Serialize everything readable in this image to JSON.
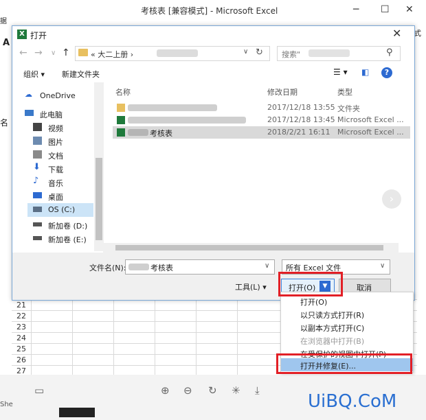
{
  "excel": {
    "title": "考核表 [兼容模式] - Microsoft Excel",
    "rows": [
      "21",
      "22",
      "23",
      "24",
      "25",
      "26",
      "27"
    ],
    "left_fragments": [
      "A",
      "名",
      "She"
    ],
    "right_fragment": "式"
  },
  "dialog": {
    "title": "打开",
    "close_glyph": "✕",
    "nav": {
      "back": "←",
      "forward": "→",
      "down": "∨",
      "up": "↑"
    },
    "address": {
      "prefix": "«",
      "crumb": "大二上册",
      "sep": "›"
    },
    "search_placeholder": "搜索\"",
    "toolbar": {
      "organize": "组织 ▾",
      "new_folder": "新建文件夹"
    },
    "nav_pane": [
      {
        "label": "OneDrive",
        "icon": "cloud-icon"
      },
      {
        "label": "此电脑",
        "icon": "computer-icon"
      },
      {
        "label": "视频",
        "icon": "video-icon"
      },
      {
        "label": "图片",
        "icon": "picture-icon"
      },
      {
        "label": "文档",
        "icon": "document-icon"
      },
      {
        "label": "下载",
        "icon": "download-icon"
      },
      {
        "label": "音乐",
        "icon": "music-icon"
      },
      {
        "label": "桌面",
        "icon": "desktop-icon"
      },
      {
        "label": "OS (C:)",
        "icon": "drive-icon"
      },
      {
        "label": "新加卷 (D:)",
        "icon": "drive-icon"
      },
      {
        "label": "新加卷 (E:)",
        "icon": "drive-icon"
      }
    ],
    "columns": {
      "name": "名称",
      "date": "修改日期",
      "type": "类型"
    },
    "files": [
      {
        "name": "",
        "date": "2017/12/18 13:55",
        "type": "文件夹",
        "icon": "folder-icon"
      },
      {
        "name": "",
        "date": "2017/12/18 13:45",
        "type": "Microsoft Excel ...",
        "icon": "excel-file-icon"
      },
      {
        "name": "考核表",
        "date": "2018/2/21 16:11",
        "type": "Microsoft Excel ...",
        "icon": "excel-file-icon"
      }
    ],
    "filename_label": "文件名(N):",
    "filename_value": "考核表",
    "filter": "所有 Excel 文件",
    "tools": "工具(L)",
    "open": "打开(O)",
    "cancel": "取消"
  },
  "menu": [
    {
      "label": "打开(O)",
      "enabled": true
    },
    {
      "label": "以只读方式打开(R)",
      "enabled": true
    },
    {
      "label": "以副本方式打开(C)",
      "enabled": true
    },
    {
      "label": "在浏览器中打开(B)",
      "enabled": false
    },
    {
      "label": "在受保护的视图中打开(P)",
      "enabled": true
    },
    {
      "label": "打开并修复(E)...",
      "enabled": true,
      "highlighted": true
    }
  ],
  "watermark": "UiBQ.CoM",
  "colors": {
    "accent": "#2d6ad1",
    "highlight": "#9fc6ee",
    "annotation": "#e21f26",
    "excel_green": "#1f7a3c"
  }
}
